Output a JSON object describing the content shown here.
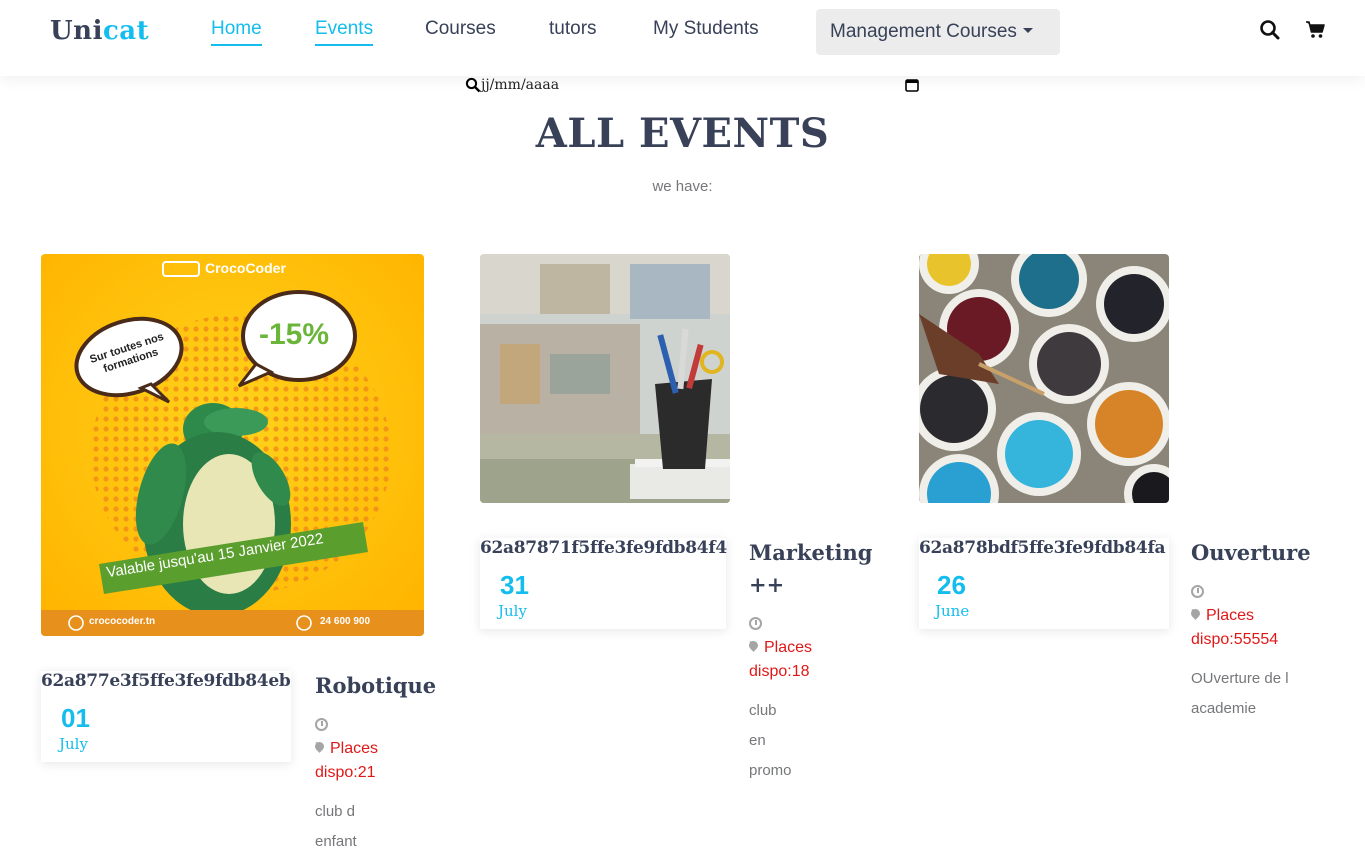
{
  "header": {
    "logo_main": "Uni",
    "logo_accent": "cat",
    "nav": [
      {
        "label": "Home",
        "active": true
      },
      {
        "label": "Events",
        "active": true
      },
      {
        "label": "Courses",
        "active": false
      },
      {
        "label": "tutors",
        "active": false
      },
      {
        "label": "My Students",
        "active": false
      }
    ],
    "dropdown_label": "Management Courses",
    "icons": [
      "search-icon",
      "cart-icon"
    ]
  },
  "datebar": {
    "date_placeholder": "jj/mm/aaaa",
    "icons": [
      "search-icon",
      "calendar-icon"
    ]
  },
  "main": {
    "title": "ALL EVENTS",
    "subtitle": "we have:"
  },
  "events": [
    {
      "id": "62a877e3f5ffe3fe9fdb84eb",
      "day": "01",
      "month": "July",
      "title": "Robotique",
      "time": "-",
      "places": "Places dispo:21",
      "description": "club d enfant",
      "image": {
        "brand": "CrocoCoder",
        "bubble_small": "Sur toutes nos formations",
        "discount": "-15%",
        "banner": "Valable jusqu'au 15 Janvier 2022",
        "site": "crococoder.tn",
        "phone": "24 600 900"
      }
    },
    {
      "id": "62a87871f5ffe3fe9fdb84f4",
      "day": "31",
      "month": "July",
      "title": "Marketing ++",
      "time": "-",
      "places": "Places dispo:18",
      "description": "club en promo"
    },
    {
      "id": "62a878bdf5ffe3fe9fdb84fa",
      "day": "26",
      "month": "June",
      "title": "Ouverture",
      "time": "-",
      "places": "Places dispo:55554",
      "description": "OUverture de l academie"
    }
  ],
  "colors": {
    "accent": "#14bdee",
    "text_dark": "#384158",
    "places_red": "#e01818",
    "promo_yellow": "#ffc20e",
    "promo_green": "#5a9e2e"
  }
}
